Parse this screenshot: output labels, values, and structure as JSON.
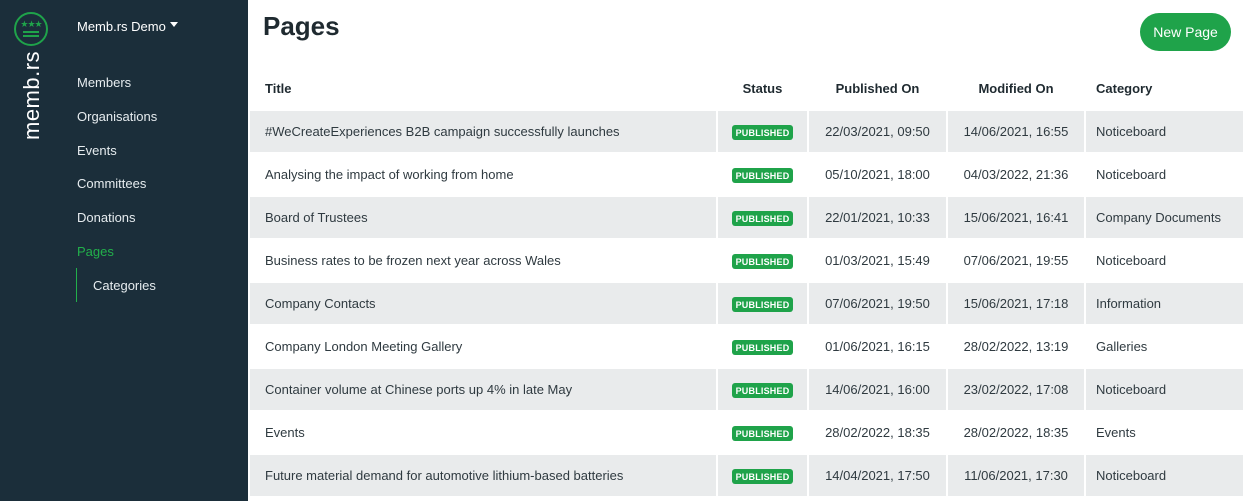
{
  "brand": {
    "vertical_text": "memb.rs",
    "accent": "#1fa34a",
    "sidebar_bg": "#1b2e3a"
  },
  "sidebar": {
    "org": "Memb.rs Demo",
    "items": [
      {
        "label": "Members"
      },
      {
        "label": "Organisations"
      },
      {
        "label": "Events"
      },
      {
        "label": "Committees"
      },
      {
        "label": "Donations"
      },
      {
        "label": "Pages",
        "active": true
      }
    ],
    "sub_items": [
      {
        "label": "Categories"
      }
    ]
  },
  "main": {
    "title": "Pages",
    "new_button": "New Page",
    "columns": {
      "title": "Title",
      "status": "Status",
      "published": "Published On",
      "modified": "Modified On",
      "category": "Category"
    },
    "rows": [
      {
        "title": "#WeCreateExperiences B2B campaign successfully launches",
        "status": "PUBLISHED",
        "published": "22/03/2021, 09:50",
        "modified": "14/06/2021, 16:55",
        "category": "Noticeboard"
      },
      {
        "title": "Analysing the impact of working from home",
        "status": "PUBLISHED",
        "published": "05/10/2021, 18:00",
        "modified": "04/03/2022, 21:36",
        "category": "Noticeboard"
      },
      {
        "title": "Board of Trustees",
        "status": "PUBLISHED",
        "published": "22/01/2021, 10:33",
        "modified": "15/06/2021, 16:41",
        "category": "Company Documents"
      },
      {
        "title": "Business rates to be frozen next year across Wales",
        "status": "PUBLISHED",
        "published": "01/03/2021, 15:49",
        "modified": "07/06/2021, 19:55",
        "category": "Noticeboard"
      },
      {
        "title": "Company Contacts",
        "status": "PUBLISHED",
        "published": "07/06/2021, 19:50",
        "modified": "15/06/2021, 17:18",
        "category": "Information"
      },
      {
        "title": "Company London Meeting Gallery",
        "status": "PUBLISHED",
        "published": "01/06/2021, 16:15",
        "modified": "28/02/2022, 13:19",
        "category": "Galleries"
      },
      {
        "title": "Container volume at Chinese ports up 4% in late May",
        "status": "PUBLISHED",
        "published": "14/06/2021, 16:00",
        "modified": "23/02/2022, 17:08",
        "category": "Noticeboard"
      },
      {
        "title": "Events",
        "status": "PUBLISHED",
        "published": "28/02/2022, 18:35",
        "modified": "28/02/2022, 18:35",
        "category": "Events"
      },
      {
        "title": "Future material demand for automotive lithium-based batteries",
        "status": "PUBLISHED",
        "published": "14/04/2021, 17:50",
        "modified": "11/06/2021, 17:30",
        "category": "Noticeboard"
      }
    ]
  }
}
